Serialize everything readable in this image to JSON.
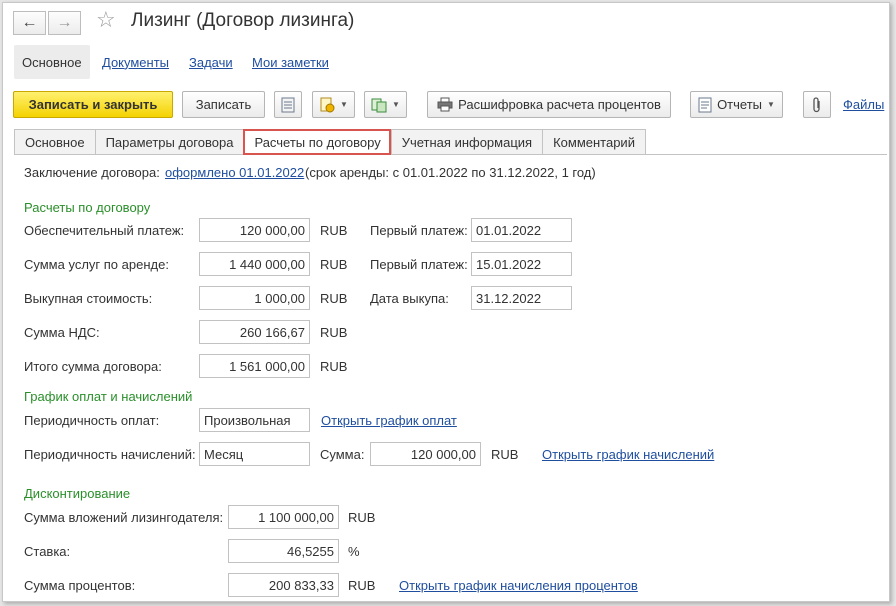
{
  "window": {
    "title": "Лизинг (Договор лизинга)",
    "back_icon": "←",
    "forward_icon": "→",
    "star_icon": "☆"
  },
  "section_tabs": [
    {
      "label": "Основное"
    },
    {
      "label": "Документы"
    },
    {
      "label": "Задачи"
    },
    {
      "label": "Мои заметки"
    }
  ],
  "toolbar": {
    "save_close": "Записать и закрыть",
    "save": "Записать",
    "decode_interest": "Расшифровка расчета процентов",
    "reports": "Отчеты",
    "files": "Файлы"
  },
  "tabs": [
    {
      "label": "Основное"
    },
    {
      "label": "Параметры договора"
    },
    {
      "label": "Расчеты по договору"
    },
    {
      "label": "Учетная информация"
    },
    {
      "label": "Комментарий"
    }
  ],
  "conclusion": {
    "label": "Заключение договора:",
    "link": "оформлено 01.01.2022",
    "text": "(срок аренды: с 01.01.2022 по 31.12.2022, 1 год)"
  },
  "calc": {
    "title": "Расчеты по договору",
    "security_label": "Обеспечительный платеж:",
    "security_value": "120 000,00",
    "security_currency": "RUB",
    "first_payment_label_1": "Первый платеж:",
    "first_payment_date_1": "01.01.2022",
    "services_label": "Сумма услуг по аренде:",
    "services_value": "1 440 000,00",
    "services_currency": "RUB",
    "first_payment_label_2": "Первый платеж:",
    "first_payment_date_2": "15.01.2022",
    "buyout_label": "Выкупная стоимость:",
    "buyout_value": "1 000,00",
    "buyout_currency": "RUB",
    "buyout_date_label": "Дата выкупа:",
    "buyout_date": "31.12.2022",
    "vat_label": "Сумма НДС:",
    "vat_value": "260 166,67",
    "vat_currency": "RUB",
    "total_label": "Итого сумма договора:",
    "total_value": "1 561 000,00",
    "total_currency": "RUB"
  },
  "schedule": {
    "title": "График оплат и начислений",
    "pay_period_label": "Периодичность оплат:",
    "pay_period_value": "Произвольная",
    "pay_schedule_link": "Открыть график оплат",
    "accrual_period_label": "Периодичность начислений:",
    "accrual_period_value": "Месяц",
    "amount_label": "Сумма:",
    "amount_value": "120 000,00",
    "amount_currency": "RUB",
    "accrual_schedule_link": "Открыть график начислений"
  },
  "discount": {
    "title": "Дисконтирование",
    "investment_label": "Сумма вложений лизингодателя:",
    "investment_value": "1 100 000,00",
    "investment_currency": "RUB",
    "rate_label": "Ставка:",
    "rate_value": "46,5255",
    "rate_unit": "%",
    "interest_label": "Сумма процентов:",
    "interest_value": "200 833,33",
    "interest_currency": "RUB",
    "interest_schedule_link": "Открыть график начисления процентов"
  }
}
